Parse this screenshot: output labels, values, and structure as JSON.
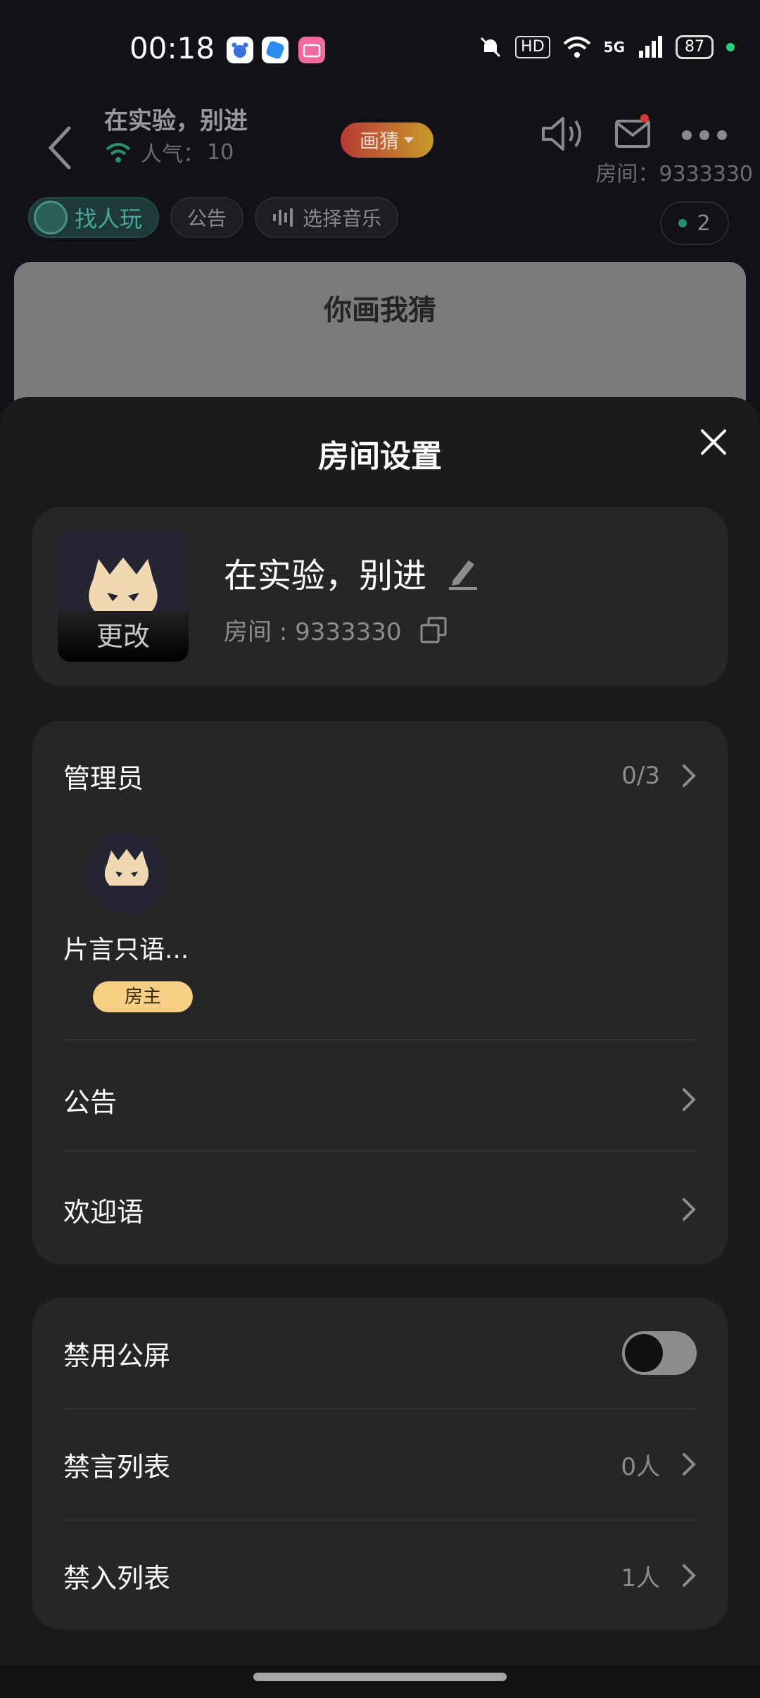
{
  "status_bar": {
    "time": "00:18",
    "hd_label": "HD",
    "network": "5G",
    "battery": "87",
    "icons": [
      "baidu-icon",
      "blue-app-icon",
      "bilibili-icon",
      "mute-bell-icon",
      "wifi-icon",
      "signal-icon"
    ]
  },
  "room": {
    "title": "在实验，别进",
    "popularity_label": "人气：",
    "popularity_value": "10",
    "mode": "画猜",
    "room_id_label": "房间：",
    "room_id": "9333330",
    "online_count": "2"
  },
  "chips": {
    "find": "找人玩",
    "notice": "公告",
    "music": "选择音乐"
  },
  "game": {
    "title": "你画我猜"
  },
  "sheet": {
    "title": "房间设置",
    "room_card": {
      "change_label": "更改",
      "name": "在实验，别进",
      "code": "房间 : 9333330"
    },
    "admins": {
      "label": "管理员",
      "count": "0/3",
      "owner_name": "片言只语...",
      "owner_badge": "房主"
    },
    "notice": {
      "label": "公告"
    },
    "welcome": {
      "label": "欢迎语"
    },
    "disable_public_screen": {
      "label": "禁用公屏",
      "enabled": false
    },
    "mute_list": {
      "label": "禁言列表",
      "count": "0人"
    },
    "ban_list": {
      "label": "禁入列表",
      "count": "1人"
    }
  },
  "colors": {
    "sheet_bg": "#1b1b1b",
    "card_bg": "#262626",
    "owner_badge": "#f6cf85",
    "accent_teal": "#4aa59c"
  }
}
